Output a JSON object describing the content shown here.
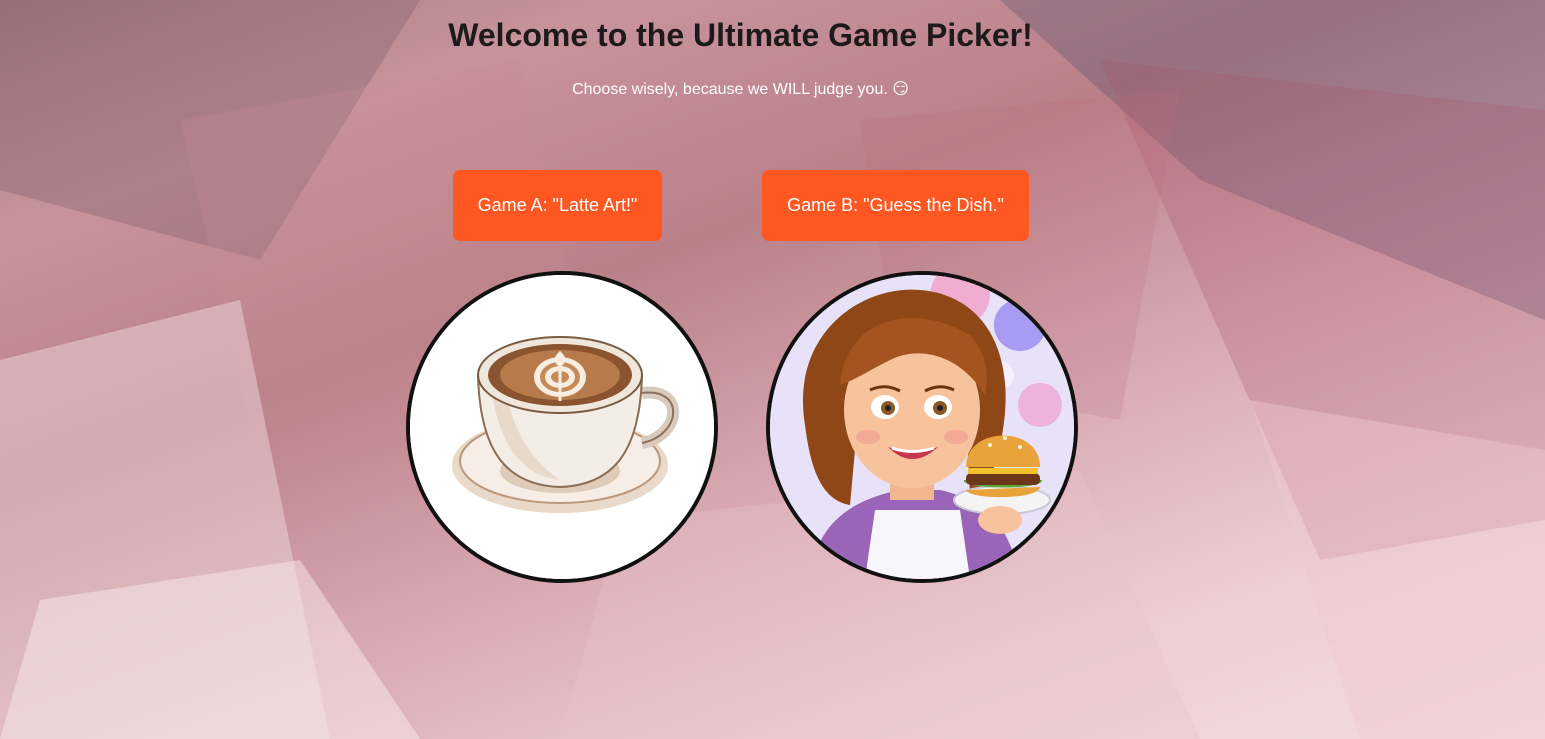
{
  "page": {
    "title": "Welcome to the Ultimate Game Picker!",
    "subtitle": "Choose wisely, because we WILL judge you. 😏"
  },
  "games": [
    {
      "label": "Game A: \"Latte Art!\"",
      "image": "latte-art-cup"
    },
    {
      "label": "Game B: \"Guess the Dish.\"",
      "image": "chef-girl-with-burger"
    }
  ],
  "colors": {
    "button": "#ff5722",
    "button_text": "#ffffff",
    "title_text": "#1e1a1b",
    "circle_border": "#111111"
  }
}
